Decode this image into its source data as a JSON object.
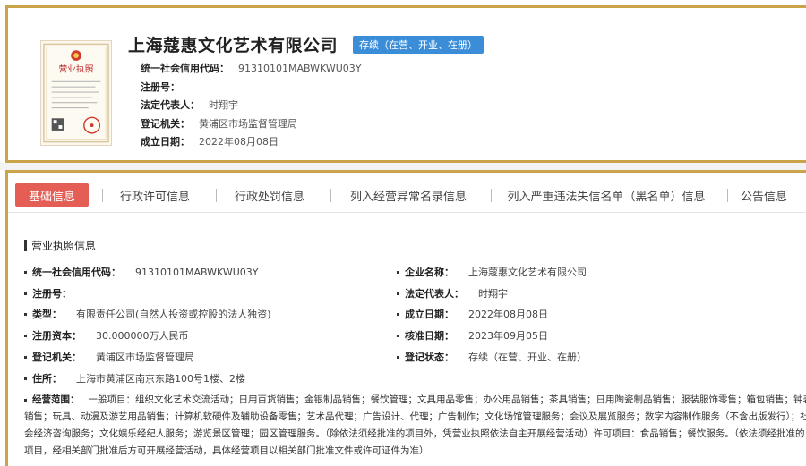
{
  "company": {
    "name": "上海蔻惠文化艺术有限公司",
    "status": "存续（在营、开业、在册）",
    "license_image_text": "营业执照"
  },
  "summary": [
    {
      "label": "统一社会信用代码：",
      "value": "91310101MABWKWU03Y"
    },
    {
      "label": "注册号：",
      "value": ""
    },
    {
      "label": "法定代表人：",
      "value": "时翔宇"
    },
    {
      "label": "登记机关：",
      "value": "黄浦区市场监督管理局"
    },
    {
      "label": "成立日期：",
      "value": "2022年08月08日"
    }
  ],
  "tabs": [
    {
      "label": "基础信息",
      "active": true
    },
    {
      "label": "行政许可信息",
      "active": false
    },
    {
      "label": "行政处罚信息",
      "active": false
    },
    {
      "label": "列入经营异常名录信息",
      "active": false
    },
    {
      "label": "列入严重违法失信名单（黑名单）信息",
      "active": false
    },
    {
      "label": "公告信息",
      "active": false
    }
  ],
  "section_title": "营业执照信息",
  "details": {
    "left": [
      {
        "label": "统一社会信用代码：",
        "value": "91310101MABWKWU03Y"
      },
      {
        "label": "注册号：",
        "value": ""
      },
      {
        "label": "类型：",
        "value": "有限责任公司(自然人投资或控股的法人独资)"
      },
      {
        "label": "注册资本：",
        "value": "30.000000万人民币"
      },
      {
        "label": "登记机关：",
        "value": "黄浦区市场监督管理局"
      },
      {
        "label": "住所：",
        "value": "上海市黄浦区南京东路100号1楼、2楼"
      }
    ],
    "right": [
      {
        "label": "企业名称：",
        "value": "上海蔻惠文化艺术有限公司"
      },
      {
        "label": "法定代表人：",
        "value": "时翔宇"
      },
      {
        "label": "成立日期：",
        "value": "2022年08月08日"
      },
      {
        "label": "核准日期：",
        "value": "2023年09月05日"
      },
      {
        "label": "登记状态：",
        "value": "存续（在营、开业、在册）"
      }
    ]
  },
  "scope": {
    "label": "经营范围：",
    "value": "一般项目：组织文化艺术交流活动；日用百货销售；金银制品销售；餐饮管理；文具用品零售；办公用品销售；茶具销售；日用陶瓷制品销售；服装服饰零售；箱包销售；钟表销售；玩具、动漫及游艺用品销售；计算机软硬件及辅助设备零售；艺术品代理；广告设计、代理；广告制作；文化场馆管理服务；会议及展览服务；数字内容制作服务（不含出版发行）；社会经济咨询服务；文化娱乐经纪人服务；游览景区管理；园区管理服务。（除依法须经批准的项目外，凭营业执照依法自主开展经营活动）许可项目：食品销售；餐饮服务。（依法须经批准的项目，经相关部门批准后方可开展经营活动，具体经营项目以相关部门批准文件或许可证件为准）"
  },
  "colors": {
    "border_gold": "#c9a44a",
    "status_blue": "#3b8dd8",
    "active_tab_red": "#e45e55"
  }
}
